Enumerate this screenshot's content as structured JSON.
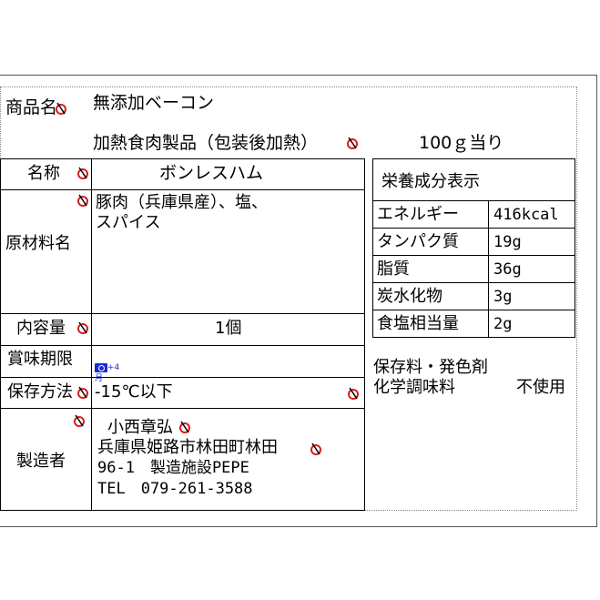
{
  "product": {
    "name_label": "商品名",
    "name_value": "無添加ベーコン",
    "category": "加熱食肉製品（包装後加熱）",
    "per_amount": "100ｇ当り"
  },
  "table": {
    "name_label": "名称",
    "name_value": "ボンレスハム",
    "ingredients_label": "原材料名",
    "ingredients_line1": "豚肉（兵庫県産）、塩、",
    "ingredients_line2": "スパイス",
    "content_label": "内容量",
    "content_value": "1個",
    "expiry_label": "賞味期限",
    "expiry_badge": "+4月",
    "storage_label": "保存方法",
    "storage_value": "-15℃以下",
    "maker_label": "製造者",
    "maker_name": "小西章弘",
    "maker_addr1": "兵庫県姫路市林田町林田",
    "maker_addr2": "96-1　製造施設PEPE",
    "maker_tel": "TEL　079-261-3588"
  },
  "nutrition": {
    "title": "栄養成分表示",
    "rows": [
      {
        "label": "エネルギー",
        "value": "416kcal"
      },
      {
        "label": "タンパク質",
        "value": "19g"
      },
      {
        "label": "脂質",
        "value": "36g"
      },
      {
        "label": "炭水化物",
        "value": "3g"
      },
      {
        "label": "食塩相当量",
        "value": "2g"
      }
    ]
  },
  "additives": {
    "line1": "保存料・発色剤",
    "line2_label": "化学調味料",
    "line2_value": "不使用"
  },
  "icons": {
    "anchor": "anchor-icon",
    "calendar": "calendar-icon"
  },
  "colors": {
    "anchor_red": "#d81e1e",
    "badge_blue": "#1a2bd6"
  }
}
